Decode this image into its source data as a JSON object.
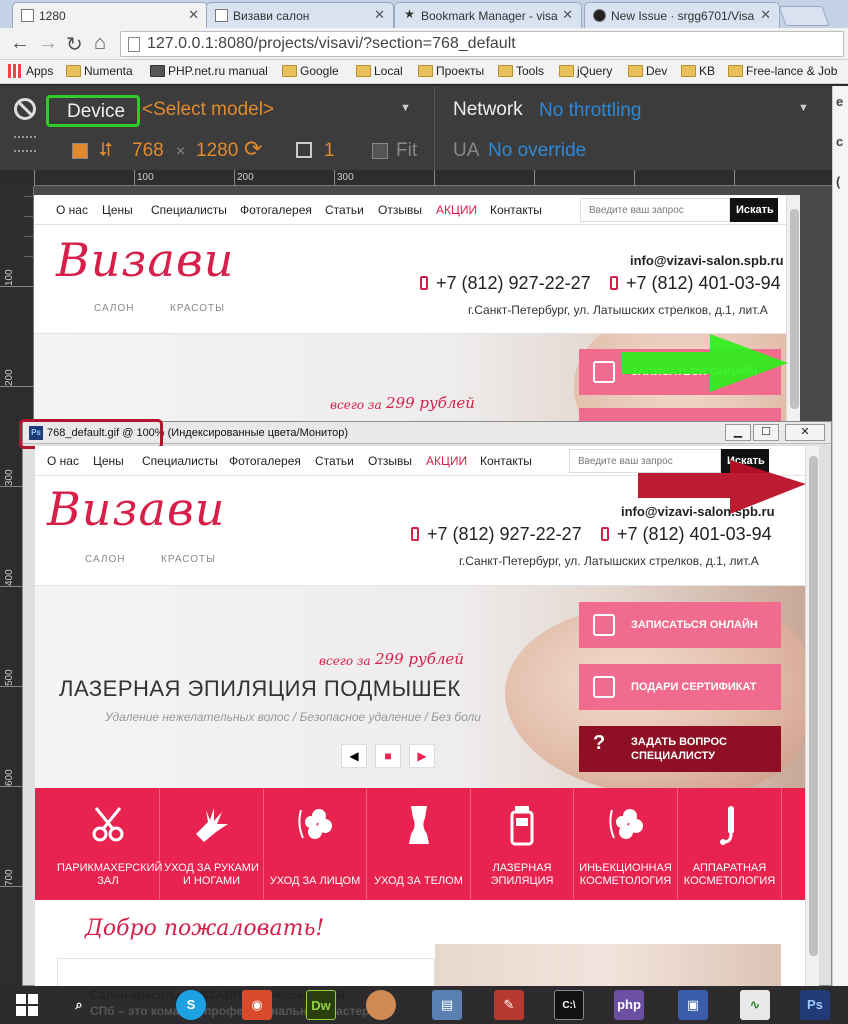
{
  "browser": {
    "tabs": [
      {
        "title": "1280",
        "active": true
      },
      {
        "title": "Визави салон",
        "active": false
      },
      {
        "title": "Bookmark Manager - visa",
        "active": false
      },
      {
        "title": "New Issue · srgg6701/Visa",
        "active": false
      }
    ],
    "url": "127.0.0.1:8080/projects/visavi/?section=768_default",
    "bookmarks": [
      "Apps",
      "Numenta",
      "PHP.net.ru manual",
      "Google",
      "Local",
      "Проекты",
      "Tools",
      "jQuery",
      "Dev",
      "KB",
      "Free-lance & Job"
    ]
  },
  "devtools": {
    "device_label": "Device",
    "model_placeholder": "<Select model>",
    "network_label": "Network",
    "throttling": "No throttling",
    "width": "768",
    "times": "×",
    "height": "1280",
    "scale": "1",
    "fit_label": "Fit",
    "ua_label": "UA",
    "ua_value": "No override",
    "ruler_h": [
      "100",
      "200",
      "300"
    ],
    "ruler_v": [
      "100",
      "200",
      "300",
      "400",
      "500",
      "600",
      "700"
    ]
  },
  "site": {
    "menu": [
      "О нас",
      "Цены",
      "Специалисты",
      "Фотогалерея",
      "Статьи",
      "Отзывы",
      "АКЦИИ",
      "Контакты"
    ],
    "search_placeholder": "Введите ваш запрос",
    "search_button": "Искать",
    "logo": "Визави",
    "logo_sub_left": "САЛОН",
    "logo_sub_right": "КРАСОТЫ",
    "email": "info@vizavi-salon.spb.ru",
    "phone1": "+7 (812) 927-22-27",
    "phone2": "+7 (812) 401-03-94",
    "address": "г.Санкт-Петербург, ул. Латышских стрелков,  д.1, лит.А",
    "price_prefix": "всего за",
    "price_value": "299 рублей",
    "hero_title": "ЛАЗЕРНАЯ ЭПИЛЯЦИЯ ПОДМЫШЕК",
    "hero_sub": "Удаление нежелательных волос   /   Безопасное удаление   /   Без боли",
    "cta": [
      "ЗАПИСАТЬСЯ ОНЛАЙН",
      "ПОДАРИ СЕРТИФИКАТ",
      "ЗАДАТЬ ВОПРОС СПЕЦИАЛИСТУ"
    ],
    "services": [
      "ПАРИКМАХЕРСКИЙ ЗАЛ",
      "УХОД ЗА РУКАМИ И НОГАМИ",
      "УХОД ЗА ЛИЦОМ",
      "УХОД ЗА ТЕЛОМ",
      "ЛАЗЕРНАЯ ЭПИЛЯЦИЯ",
      "ИНЬЕКЦИОННАЯ КОСМЕТОЛОГИЯ",
      "АППАРАТНАЯ КОСМЕТОЛОГИЯ"
    ],
    "welcome": "Добро пожаловать!",
    "body_snippet_1": "Салон красоты «ВИЗАВИ» на Невском рай",
    "body_snippet_2": "СПб – это команда профессиональных мастеров"
  },
  "photoshop": {
    "title": "768_default.gif @ 100% (Индексированные цвета/Монитор)",
    "ps_icon": "Ps"
  },
  "taskbar": {
    "items": [
      "start",
      "search",
      "skype",
      "eye-app",
      "dreamweaver",
      "browser-ball",
      "folder-app",
      "paint-app",
      "terminal",
      "php-storm",
      "floppy",
      "chart-app",
      "photoshop"
    ]
  },
  "colors": {
    "brand": "#e8234f",
    "accent_pink": "#f06b8d",
    "accent_dark": "#8f1025",
    "devtools_orange": "#e18a2d",
    "devtools_blue": "#2e88d6",
    "highlight_green": "#2ecc24",
    "highlight_red": "#b0162d"
  }
}
